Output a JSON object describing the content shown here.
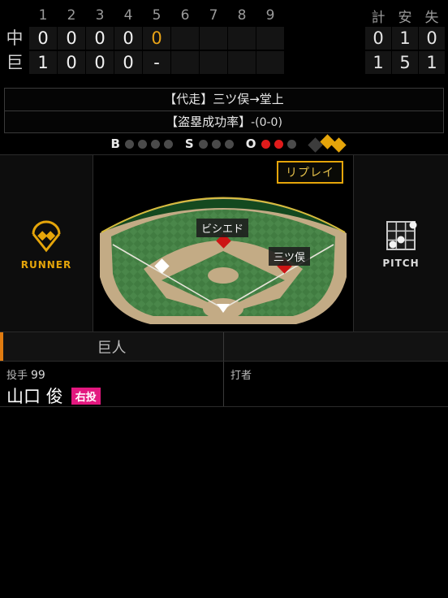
{
  "scoreboard": {
    "inning_headers": [
      "1",
      "2",
      "3",
      "4",
      "5",
      "6",
      "7",
      "8",
      "9"
    ],
    "total_headers": [
      "計",
      "安",
      "失"
    ],
    "rows": [
      {
        "team": "中",
        "innings": [
          "0",
          "0",
          "0",
          "0",
          "0",
          "",
          "",
          "",
          ""
        ],
        "current_index": 4,
        "totals": [
          "0",
          "1",
          "0"
        ]
      },
      {
        "team": "巨",
        "innings": [
          "1",
          "0",
          "0",
          "0",
          "-",
          "",
          "",
          "",
          ""
        ],
        "current_index": -1,
        "totals": [
          "1",
          "5",
          "1"
        ]
      }
    ]
  },
  "messages": {
    "line1": "【代走】三ツ俣→堂上",
    "line2_label": "【盗塁成功率】",
    "line2_value": "-(0-0)"
  },
  "count": {
    "ball_label": "B",
    "balls": [
      false,
      false,
      false,
      false
    ],
    "strike_label": "S",
    "strikes": [
      false,
      false,
      false
    ],
    "out_label": "O",
    "outs": [
      true,
      true,
      false
    ]
  },
  "field": {
    "replay_label": "リプレイ",
    "runners": [
      {
        "base": "second",
        "name": "ビシエド",
        "occupied": true
      },
      {
        "base": "first",
        "name": "三ツ俣",
        "occupied": true
      },
      {
        "base": "third",
        "name": "",
        "occupied": false
      }
    ],
    "left_panel_label": "RUNNER",
    "right_panel_label": "PITCH"
  },
  "panels": {
    "pitcher": {
      "team": "巨人",
      "role_label": "投手",
      "number": "99",
      "name": "山口 俊",
      "hand_badge": "右投"
    },
    "batter": {
      "team": "",
      "role_label": "打者",
      "number": "",
      "name": "",
      "hand_badge": ""
    }
  },
  "colors": {
    "accent_orange": "#e07b10",
    "gold": "#e5a50a",
    "out_red": "#e01b1b",
    "hand_pink": "#e3187f",
    "grass": "#3f7a3f",
    "dirt": "#c3ab85"
  }
}
